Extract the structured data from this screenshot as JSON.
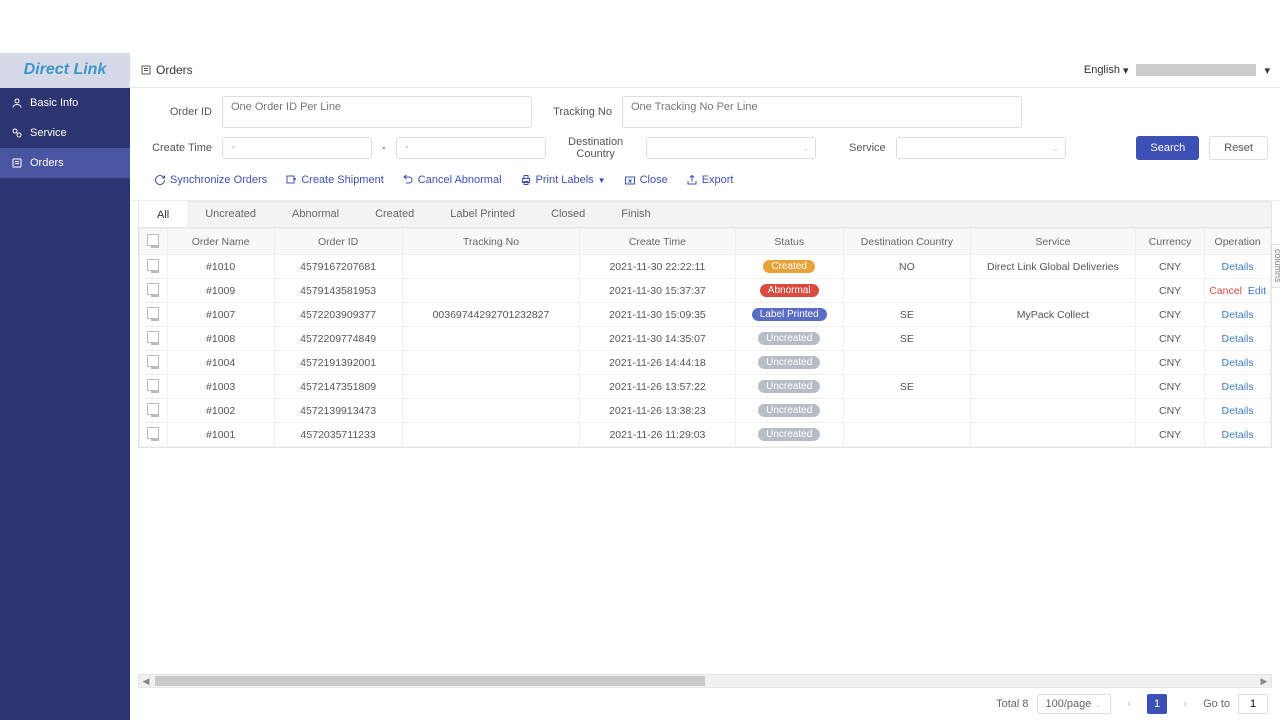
{
  "brand": "Direct Link",
  "sidebar": {
    "items": [
      {
        "label": "Basic Info"
      },
      {
        "label": "Service"
      },
      {
        "label": "Orders"
      }
    ]
  },
  "topbar": {
    "title": "Orders",
    "language": "English"
  },
  "filters": {
    "order_id_label": "Order ID",
    "order_id_placeholder": "One Order ID Per Line",
    "tracking_label": "Tracking No",
    "tracking_placeholder": "One Tracking No Per Line",
    "create_time_label": "Create Time",
    "date_separator": "-",
    "dest_country_label": "Destination Country",
    "service_label": "Service",
    "search_btn": "Search",
    "reset_btn": "Reset"
  },
  "actions": {
    "sync": "Synchronize Orders",
    "create_shipment": "Create Shipment",
    "cancel_abnormal": "Cancel Abnormal",
    "print_labels": "Print Labels",
    "close": "Close",
    "export": "Export"
  },
  "tabs": [
    "All",
    "Uncreated",
    "Abnormal",
    "Created",
    "Label Printed",
    "Closed",
    "Finish"
  ],
  "table": {
    "headers": [
      "",
      "Order Name",
      "Order ID",
      "Tracking No",
      "Create Time",
      "Status",
      "Destination Country",
      "Service",
      "Currency",
      "Operation"
    ],
    "rows": [
      {
        "name": "#1010",
        "order_id": "4579167207681",
        "tracking": "",
        "time": "2021-11-30 22:22:11",
        "status": "Created",
        "status_type": "created",
        "country": "NO",
        "service": "Direct Link Global Deliveries",
        "currency": "CNY",
        "ops": [
          "Details"
        ]
      },
      {
        "name": "#1009",
        "order_id": "4579143581953",
        "tracking": "",
        "time": "2021-11-30 15:37:37",
        "status": "Abnormal",
        "status_type": "abnormal",
        "country": "",
        "service": "",
        "currency": "CNY",
        "ops": [
          "Cancel",
          "Edit"
        ]
      },
      {
        "name": "#1007",
        "order_id": "4572203909377",
        "tracking": "00369744292701232827",
        "time": "2021-11-30 15:09:35",
        "status": "Label Printed",
        "status_type": "printed",
        "country": "SE",
        "service": "MyPack Collect",
        "currency": "CNY",
        "ops": [
          "Details"
        ]
      },
      {
        "name": "#1008",
        "order_id": "4572209774849",
        "tracking": "",
        "time": "2021-11-30 14:35:07",
        "status": "Uncreated",
        "status_type": "uncreated",
        "country": "SE",
        "service": "",
        "currency": "CNY",
        "ops": [
          "Details"
        ]
      },
      {
        "name": "#1004",
        "order_id": "4572191392001",
        "tracking": "",
        "time": "2021-11-26 14:44:18",
        "status": "Uncreated",
        "status_type": "uncreated",
        "country": "",
        "service": "",
        "currency": "CNY",
        "ops": [
          "Details"
        ]
      },
      {
        "name": "#1003",
        "order_id": "4572147351809",
        "tracking": "",
        "time": "2021-11-26 13:57:22",
        "status": "Uncreated",
        "status_type": "uncreated",
        "country": "SE",
        "service": "",
        "currency": "CNY",
        "ops": [
          "Details"
        ]
      },
      {
        "name": "#1002",
        "order_id": "4572139913473",
        "tracking": "",
        "time": "2021-11-26 13:38:23",
        "status": "Uncreated",
        "status_type": "uncreated",
        "country": "",
        "service": "",
        "currency": "CNY",
        "ops": [
          "Details"
        ]
      },
      {
        "name": "#1001",
        "order_id": "4572035711233",
        "tracking": "",
        "time": "2021-11-26 11:29:03",
        "status": "Uncreated",
        "status_type": "uncreated",
        "country": "",
        "service": "",
        "currency": "CNY",
        "ops": [
          "Details"
        ]
      }
    ],
    "columns_handle": "columns"
  },
  "pagination": {
    "total_label": "Total 8",
    "page_size": "100/page",
    "current": "1",
    "goto_label": "Go to",
    "goto_value": "1"
  }
}
